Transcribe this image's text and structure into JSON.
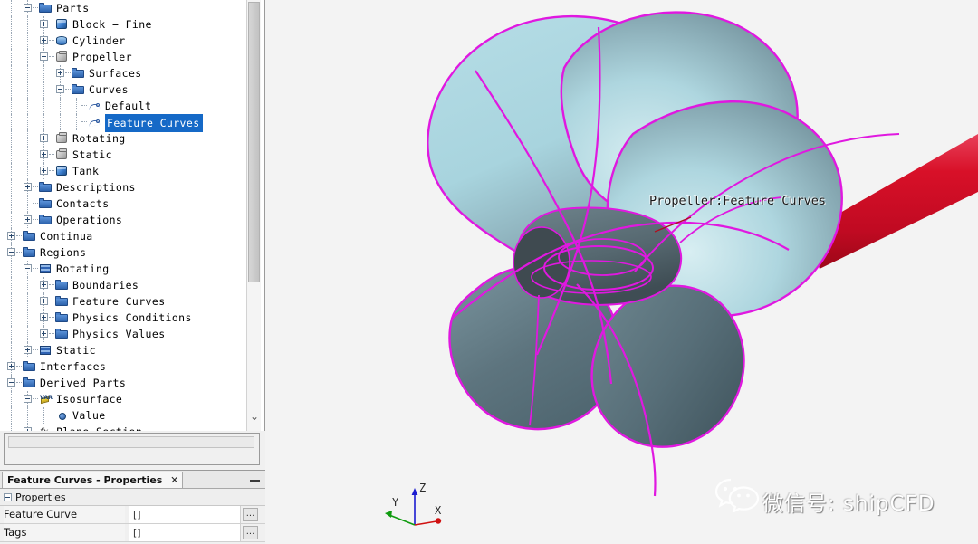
{
  "tree": {
    "nodes": [
      {
        "label": "Parts",
        "depth": 1,
        "icon": "folder",
        "toggle": "minus",
        "selected": false
      },
      {
        "label": "Block − Fine",
        "depth": 2,
        "icon": "cube",
        "toggle": "plus",
        "selected": false
      },
      {
        "label": "Cylinder",
        "depth": 2,
        "icon": "cyl",
        "toggle": "plus",
        "selected": false
      },
      {
        "label": "Propeller",
        "depth": 2,
        "icon": "gray",
        "toggle": "minus",
        "selected": false
      },
      {
        "label": "Surfaces",
        "depth": 3,
        "icon": "folder",
        "toggle": "plus",
        "selected": false
      },
      {
        "label": "Curves",
        "depth": 3,
        "icon": "folder",
        "toggle": "minus",
        "selected": false
      },
      {
        "label": "Default",
        "depth": 4,
        "icon": "curve",
        "toggle": "none",
        "selected": false
      },
      {
        "label": "Feature Curves",
        "depth": 4,
        "icon": "curve",
        "toggle": "none",
        "selected": true
      },
      {
        "label": "Rotating",
        "depth": 2,
        "icon": "gray",
        "toggle": "plus",
        "selected": false
      },
      {
        "label": "Static",
        "depth": 2,
        "icon": "gray",
        "toggle": "plus",
        "selected": false
      },
      {
        "label": "Tank",
        "depth": 2,
        "icon": "cube",
        "toggle": "plus",
        "selected": false
      },
      {
        "label": "Descriptions",
        "depth": 1,
        "icon": "folder",
        "toggle": "plus",
        "selected": false
      },
      {
        "label": "Contacts",
        "depth": 1,
        "icon": "folder",
        "toggle": "none",
        "selected": false
      },
      {
        "label": "Operations",
        "depth": 1,
        "icon": "folder",
        "toggle": "plus",
        "selected": false
      },
      {
        "label": "Continua",
        "depth": 0,
        "icon": "folder",
        "toggle": "plus",
        "selected": false
      },
      {
        "label": "Regions",
        "depth": 0,
        "icon": "folder",
        "toggle": "minus",
        "selected": false
      },
      {
        "label": "Rotating",
        "depth": 1,
        "icon": "region",
        "toggle": "minus",
        "selected": false
      },
      {
        "label": "Boundaries",
        "depth": 2,
        "icon": "folder",
        "toggle": "plus",
        "selected": false
      },
      {
        "label": "Feature Curves",
        "depth": 2,
        "icon": "folder",
        "toggle": "plus",
        "selected": false
      },
      {
        "label": "Physics Conditions",
        "depth": 2,
        "icon": "folder",
        "toggle": "plus",
        "selected": false
      },
      {
        "label": "Physics Values",
        "depth": 2,
        "icon": "folder",
        "toggle": "plus",
        "selected": false
      },
      {
        "label": "Static",
        "depth": 1,
        "icon": "region",
        "toggle": "plus",
        "selected": false
      },
      {
        "label": "Interfaces",
        "depth": 0,
        "icon": "folder",
        "toggle": "plus",
        "selected": false
      },
      {
        "label": "Derived Parts",
        "depth": 0,
        "icon": "folder",
        "toggle": "minus",
        "selected": false
      },
      {
        "label": "Isosurface",
        "depth": 1,
        "icon": "iso",
        "toggle": "minus",
        "selected": false
      },
      {
        "label": "Value",
        "depth": 2,
        "icon": "dot",
        "toggle": "none",
        "selected": false
      },
      {
        "label": "Plane Section",
        "depth": 1,
        "icon": "fx",
        "toggle": "plus",
        "selected": false
      }
    ],
    "scrollbar": {
      "down_arrow": "⌄"
    }
  },
  "filter": {
    "value": ""
  },
  "properties": {
    "tab_title": "Feature Curves - Properties",
    "close_icon": "✕",
    "minimize_icon": "—",
    "group_header": "Properties",
    "rows": [
      {
        "name": "Feature Curve",
        "value": "[]",
        "button": "..."
      },
      {
        "name": "Tags",
        "value": "[]",
        "button": "..."
      }
    ]
  },
  "viewport": {
    "scene_label": "Propeller:Feature Curves",
    "triad": {
      "axes": [
        {
          "name": "Z",
          "color": "#1c1cd0"
        },
        {
          "name": "Y",
          "color": "#0f9b0f"
        },
        {
          "name": "X",
          "color": "#d01010"
        }
      ]
    },
    "watermark": {
      "text": "微信号: shipCFD"
    },
    "colors": {
      "background": "#f3f3f3",
      "blade_light": "#bfe0e6",
      "blade_dark": "#5b7079",
      "feature_curve": "#e018e0",
      "shaft": "#d81028",
      "hub": "#4a5258"
    }
  }
}
